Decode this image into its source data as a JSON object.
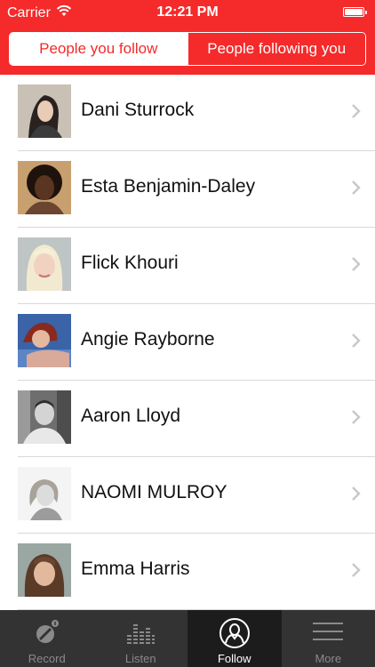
{
  "status_bar": {
    "carrier": "Carrier",
    "time": "12:21 PM"
  },
  "segments": {
    "following": "People you follow",
    "followers": "People following you"
  },
  "people": [
    {
      "name": "Dani Sturrock"
    },
    {
      "name": "Esta Benjamin-Daley"
    },
    {
      "name": "Flick Khouri"
    },
    {
      "name": "Angie Rayborne"
    },
    {
      "name": "Aaron Lloyd"
    },
    {
      "name": "NAOMI MULROY"
    },
    {
      "name": "Emma Harris"
    }
  ],
  "tabs": [
    {
      "label": "Record",
      "icon": "record-icon"
    },
    {
      "label": "Listen",
      "icon": "listen-icon"
    },
    {
      "label": "Follow",
      "icon": "follow-icon",
      "selected": true
    },
    {
      "label": "More",
      "icon": "more-icon"
    }
  ],
  "colors": {
    "accent": "#f52a2a",
    "tab_bar": "#333333",
    "tab_selected": "#1c1c1c"
  }
}
